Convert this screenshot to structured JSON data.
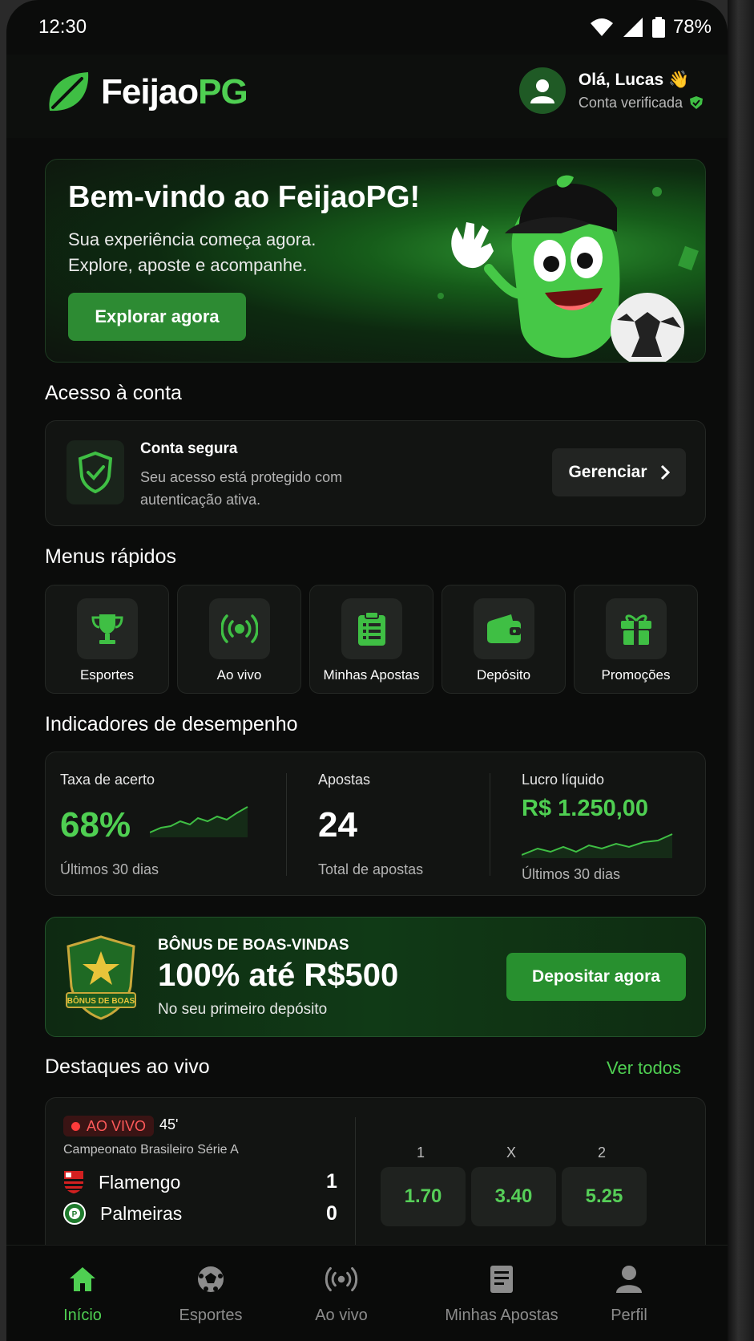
{
  "status_bar": {
    "time": "12:30",
    "battery": "78%"
  },
  "header": {
    "brand_part1": "Feijao",
    "brand_part2": "PG",
    "greeting": "Olá, Lucas 👋",
    "verified_text": "Conta verificada"
  },
  "hero": {
    "title": "Bem-vindo ao FeijaoPG!",
    "subtitle": "Sua experiência começa agora. Explore, aposte e acompanhe.",
    "button": "Explorar agora"
  },
  "account": {
    "section_title": "Acesso à conta",
    "title": "Conta segura",
    "text": "Seu acesso está protegido com autenticação ativa.",
    "button": "Gerenciar"
  },
  "quick_menu": {
    "section_title": "Menus rápidos",
    "items": [
      {
        "label": "Esportes",
        "icon": "trophy-icon"
      },
      {
        "label": "Ao vivo",
        "icon": "broadcast-icon"
      },
      {
        "label": "Minhas Apostas",
        "icon": "clipboard-icon"
      },
      {
        "label": "Depósito",
        "icon": "wallet-icon"
      },
      {
        "label": "Promoções",
        "icon": "gift-icon"
      }
    ]
  },
  "indicators": {
    "section_title": "Indicadores de desempenho",
    "hit_rate": {
      "label": "Taxa de acerto",
      "value": "68%",
      "footnote": "Últimos 30 dias"
    },
    "bets": {
      "label": "Apostas",
      "value": "24",
      "footnote": "Total de apostas"
    },
    "profit": {
      "label": "Lucro líquido",
      "value": "R$ 1.250,00",
      "footnote": "Últimos 30 dias"
    }
  },
  "bonus": {
    "badge_text": "BÔNUS DE BOAS",
    "kicker": "BÔNUS DE BOAS-VINDAS",
    "headline": "100% até R$500",
    "sub": "No seu primeiro depósito",
    "button": "Depositar agora"
  },
  "live": {
    "section_title": "Destaques ao vivo",
    "see_all": "Ver todos",
    "badge": "AO VIVO",
    "minute": "45'",
    "league": "Campeonato Brasileiro Série A",
    "home": {
      "name": "Flamengo",
      "score": "1"
    },
    "away": {
      "name": "Palmeiras",
      "score": "0"
    },
    "odds_labels": [
      "1",
      "X",
      "2"
    ],
    "odds": [
      "1.70",
      "3.40",
      "5.25"
    ]
  },
  "bottom_nav": {
    "items": [
      {
        "label": "Início",
        "icon": "home-icon",
        "active": true
      },
      {
        "label": "Esportes",
        "icon": "soccer-ball-icon"
      },
      {
        "label": "Ao vivo",
        "icon": "broadcast-icon"
      },
      {
        "label": "Minhas Apostas",
        "icon": "receipt-icon"
      },
      {
        "label": "Perfil",
        "icon": "user-icon"
      }
    ]
  },
  "colors": {
    "accent": "#4fcf52",
    "button_green": "#2d8b33",
    "live_red": "#ff3b3b",
    "background": "#0b0c0b"
  }
}
